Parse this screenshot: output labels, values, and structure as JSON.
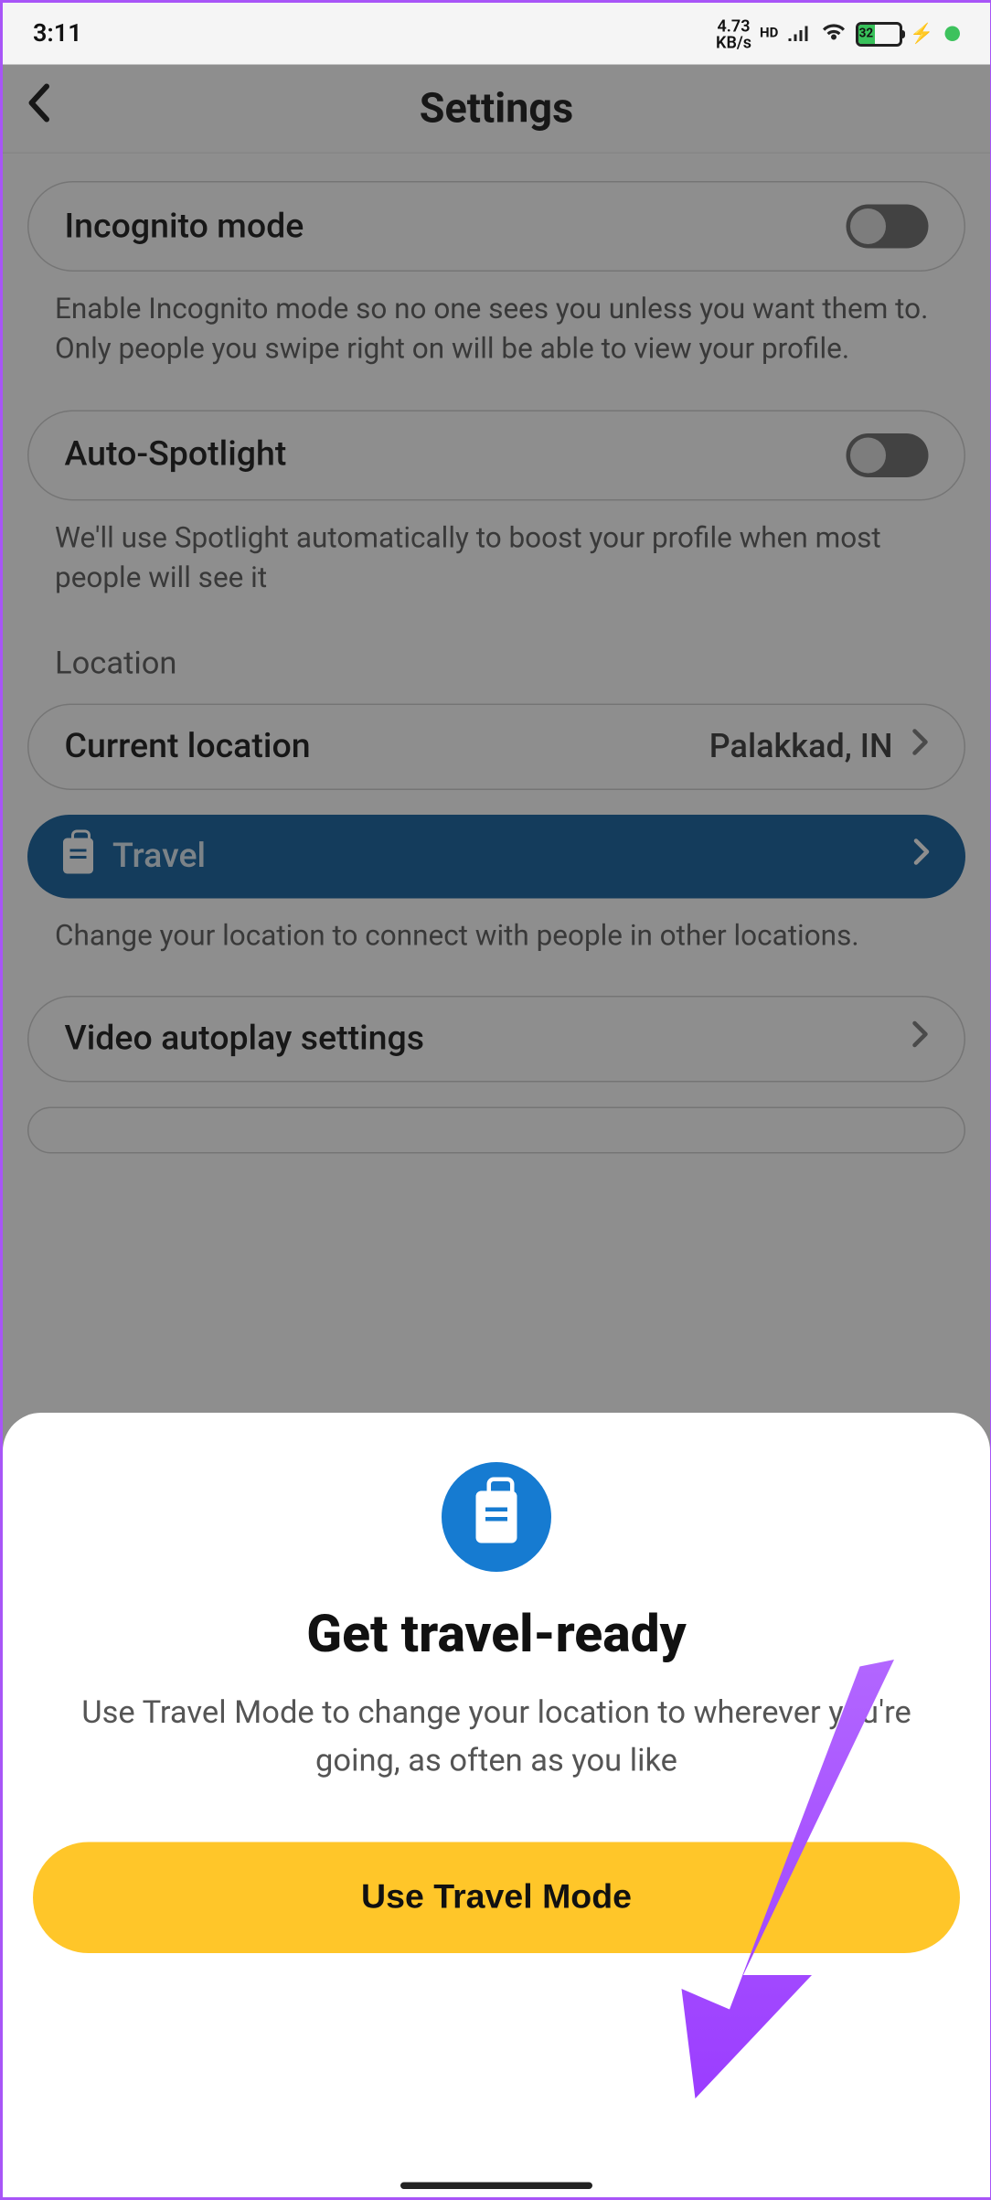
{
  "statusbar": {
    "time": "3:11",
    "netspeed_top": "4.73",
    "netspeed_bottom": "KB/s",
    "hd": "HD",
    "battery_pct": "32"
  },
  "header": {
    "title": "Settings"
  },
  "incognito": {
    "label": "Incognito mode",
    "desc": "Enable Incognito mode so no one sees you unless you want them to. Only people you swipe right on will be able to view your profile."
  },
  "autospotlight": {
    "label": "Auto-Spotlight",
    "desc": "We'll use Spotlight automatically to boost your profile when most people will see it"
  },
  "location_section": {
    "heading": "Location",
    "current_label": "Current location",
    "current_value": "Palakkad, IN"
  },
  "travel": {
    "label": "Travel",
    "desc": "Change your location to connect with people in other locations."
  },
  "video": {
    "label": "Video autoplay settings"
  },
  "sheet": {
    "title": "Get travel-ready",
    "body": "Use Travel Mode to change your location to wherever you're going, as often as you like",
    "cta": "Use Travel Mode"
  }
}
